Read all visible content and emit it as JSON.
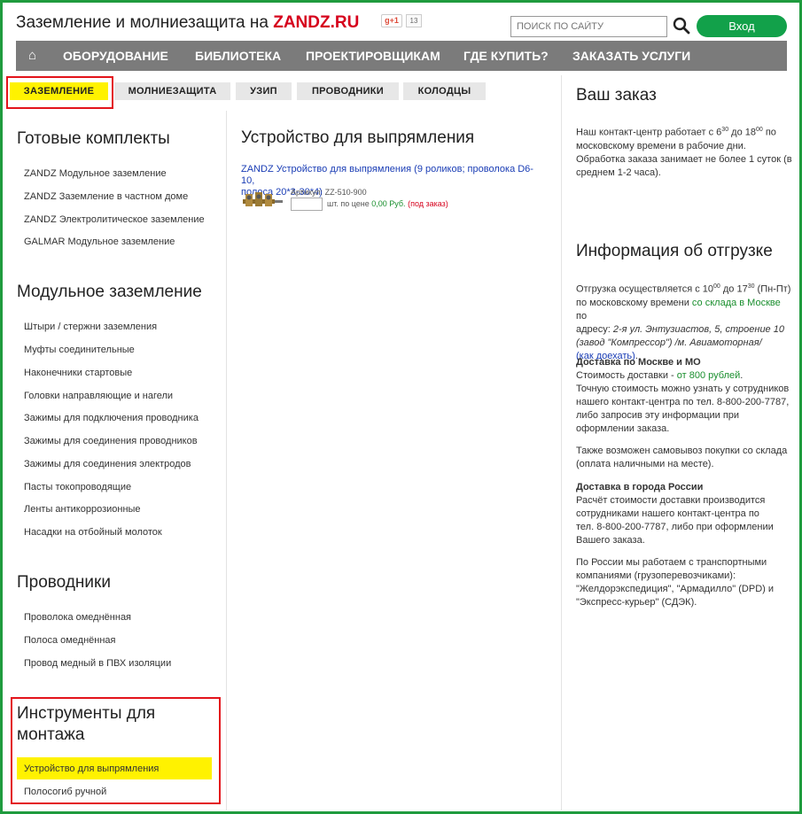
{
  "header": {
    "title_prefix": "Заземление и молниезащита на ",
    "title_brand": "ZANDZ.RU",
    "gplus_label": "+1",
    "gplus_count": "13",
    "search_placeholder": "ПОИСК ПО САЙТУ",
    "login_label": "Вход"
  },
  "nav": {
    "home_icon": "⌂",
    "items": [
      "ОБОРУДОВАНИЕ",
      "БИБЛИОТЕКА",
      "ПРОЕКТИРОВЩИКАМ",
      "ГДЕ КУПИТЬ?",
      "ЗАКАЗАТЬ УСЛУГИ"
    ]
  },
  "tabs": [
    "ЗАЗЕМЛЕНИЕ",
    "МОЛНИЕЗАЩИТА",
    "УЗИП",
    "ПРОВОДНИКИ",
    "КОЛОДЦЫ"
  ],
  "sidebar": {
    "sections": [
      {
        "title": "Готовые комплекты",
        "items": [
          "ZANDZ Модульное заземление",
          "ZANDZ Заземление в частном доме",
          "ZANDZ Электролитическое заземление",
          "GALMAR Модульное заземление"
        ]
      },
      {
        "title": "Модульное заземление",
        "items": [
          "Штыри / стержни заземления",
          "Муфты соединительные",
          "Наконечники стартовые",
          "Головки направляющие и нагели",
          "Зажимы для подключения проводника",
          "Зажимы для соединения проводников",
          "Зажимы для соединения электродов",
          "Пасты токопроводящие",
          "Ленты антикоррозионные",
          "Насадки на отбойный молоток"
        ]
      },
      {
        "title": "Проводники",
        "items": [
          "Проволока омеднённая",
          "Полоса омеднённая",
          "Провод медный в ПВХ изоляции"
        ]
      },
      {
        "title_line1": "Инструменты для",
        "title_line2": "монтажа",
        "items": [
          "Устройство для выпрямления",
          "Полосогиб ручной"
        ]
      }
    ]
  },
  "main": {
    "title": "Устройство для выпрямления",
    "product": {
      "name_line1": "ZANDZ Устройство для выпрямления (9 роликов; проволока D6-10,",
      "name_line2": "полоса 20*3-30*4)",
      "article_label": "Артикул:",
      "article_value": "ZZ-510-900",
      "qty_suffix": "шт. по цене",
      "price": "0,00 Руб.",
      "order_note": "(под заказ)"
    }
  },
  "right": {
    "order_title": "Ваш заказ",
    "order_text": {
      "l1_a": "Наш контакт-центр работает с 6",
      "l1_sup1": "30",
      "l1_b": " до 18",
      "l1_sup2": "00",
      "l1_c": " по",
      "l2": "московскому времени в рабочие дни.",
      "l3": "Обработка заказа занимает не более 1 суток (в",
      "l4": "среднем 1-2 часа)."
    },
    "ship_title": "Информация об отгрузке",
    "ship_text": {
      "l1_a": "Отгрузка осуществляется с 10",
      "l1_sup1": "00",
      "l1_b": " до 17",
      "l1_sup2": "30",
      "l1_c": " (Пн-Пт)",
      "l2_a": "по московскому времени ",
      "l2_link": "со склада в Москве",
      "l2_b": " по",
      "l3_a": "адресу: ",
      "l3_b": "2-я ул. Энтузиастов, 5, строение 10",
      "l4": "(завод \"Компрессор\") /м. Авиамоторная/",
      "l5": "(как доехать)",
      "l5_end": "."
    },
    "moscow": {
      "title": "Доставка по Москве и МО",
      "l1_a": "Стоимость доставки - ",
      "l1_b": "от 800 рублей",
      "l1_c": ".",
      "l2": "Точную стоимость можно узнать у сотрудников",
      "l3": "нашего контакт-центра по тел. 8-800-200-7787,",
      "l4": "либо запросив эту информации при",
      "l5": "оформлении заказа."
    },
    "pickup": {
      "l1": "Также возможен самовывоз покупки со склада",
      "l2": "(оплата наличными на месте)."
    },
    "russia": {
      "title": "Доставка в города России",
      "l1": "Расчёт стоимости доставки производится",
      "l2": "сотрудниками нашего контакт-центра по",
      "l3": "тел. 8-800-200-7787, либо при оформлении",
      "l4": "Вашего заказа."
    },
    "transport": {
      "l1": "По России мы работаем с транспортными",
      "l2": "компаниями (грузоперевозчиками):",
      "l3": "\"Желдорэкспедиция\", \"Армадилло\" (DPD) и",
      "l4": "\"Экспресс-курьер\" (СДЭК)."
    }
  }
}
